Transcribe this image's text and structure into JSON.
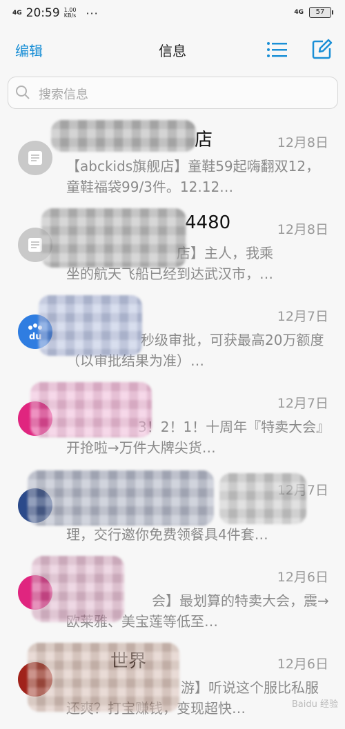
{
  "status_bar": {
    "signal_left": "4G",
    "time": "20:59",
    "speed_value": "1.00",
    "speed_unit": "KB/s",
    "dots": "···",
    "signal_right": "4G",
    "battery": "57"
  },
  "nav": {
    "edit_label": "编辑",
    "title": "信息"
  },
  "search": {
    "placeholder": "搜索信息"
  },
  "messages": [
    {
      "sender": "店",
      "date": "12月8日",
      "preview": "【abckids旗舰店】童鞋59起嗨翻双12，童鞋福袋99/3件。12.12…",
      "avatar_color": "#c9c9c9"
    },
    {
      "sender": "4480",
      "date": "12月8日",
      "preview": "坐的航天飞船已经到达武汉市，…",
      "preview_top": "店】主人，我乘",
      "avatar_color": "#c9c9c9"
    },
    {
      "sender": "",
      "date": "12月7日",
      "preview": "秒级审批，可获最高20万额度（以审批结果为准）…",
      "avatar_color": "#2f7de1"
    },
    {
      "sender": "",
      "date": "12月7日",
      "preview": "3！2！1！十周年『特卖大会』开抢啦→万件大牌尖货…",
      "avatar_color": "#e0257f"
    },
    {
      "sender": "",
      "date": "12月7日",
      "preview": "理，交行邀你免费领餐具4件套…",
      "avatar_color": "#2b4a8a"
    },
    {
      "sender": "",
      "date": "12月6日",
      "preview": "会】最划算的特卖大会，震→欧莱雅、美宝莲等低至…",
      "avatar_color": "#e0257f"
    },
    {
      "sender": "世界",
      "date": "12月6日",
      "preview": "游】听说这个服比私服还爽？打宝赚钱，变现超快…",
      "avatar_color": "#a0221a"
    }
  ],
  "watermark": "Baidu 经验"
}
